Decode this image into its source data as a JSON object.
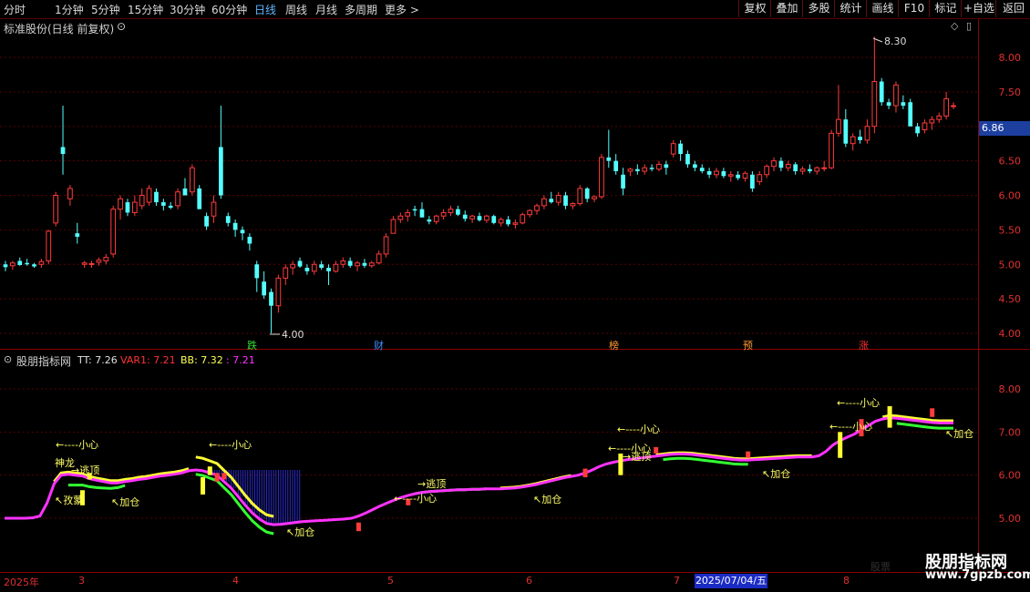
{
  "toolbar": {
    "periods": [
      "分时",
      "1分钟",
      "5分钟",
      "15分钟",
      "30分钟",
      "60分钟",
      "日线",
      "周线",
      "月线",
      "多周期",
      "更多 >"
    ],
    "active_period": "日线",
    "buttons": [
      "复权",
      "叠加",
      "多股",
      "统计",
      "画线",
      "F10",
      "标记",
      "+自选",
      "返回"
    ]
  },
  "main_panel": {
    "title": "标准股份(日线 前复权)",
    "y_ticks": [
      "8.00",
      "7.50",
      "7.00",
      "6.50",
      "6.00",
      "5.50",
      "5.00",
      "4.50",
      "4.00"
    ],
    "current_price": "6.86",
    "high_label": "8.30",
    "low_label": "4.00",
    "events": [
      {
        "text": "跌",
        "color": "#33dd33"
      },
      {
        "text": "财",
        "color": "#3d8fff"
      },
      {
        "text": "榜",
        "color": "#ff9933"
      },
      {
        "text": "预",
        "color": "#ff9933"
      },
      {
        "text": "涨",
        "color": "#ff3333"
      }
    ]
  },
  "indicator_panel": {
    "title": "股朋指标网",
    "tt": "TT: 7.26",
    "var1": "VAR1: 7.21",
    "bb": "BB: 7.32",
    "extra": ": 7.21",
    "y_ticks": [
      "8.00",
      "7.00",
      "6.00",
      "5.00"
    ],
    "annotations": {
      "caution": "←----小心",
      "escape": "→逃顶",
      "add": "↖加仓",
      "shenlong": "神龙",
      "nizhuan": "↖孜蒙"
    }
  },
  "x_axis": {
    "labels": [
      "2025年",
      "3",
      "4",
      "5",
      "6",
      "7",
      "8"
    ],
    "cursor_date": "2025/07/04/五"
  },
  "colors": {
    "up": "#ff3b3b",
    "down": "#54ffff",
    "grid": "#5a0000",
    "magenta": "#ff33ff",
    "green": "#33ff33",
    "yellow": "#ffff33"
  },
  "chart_data": {
    "type": "candlestick",
    "ohlc": [
      [
        5.0,
        5.05,
        4.9,
        4.96
      ],
      [
        4.98,
        5.05,
        4.92,
        5.02
      ],
      [
        5.05,
        5.1,
        4.98,
        4.99
      ],
      [
        5.02,
        5.08,
        4.98,
        5.0
      ],
      [
        5.0,
        5.02,
        4.95,
        4.97
      ],
      [
        5.0,
        5.08,
        4.95,
        5.04
      ],
      [
        5.05,
        5.5,
        5.0,
        5.48
      ],
      [
        5.6,
        6.05,
        5.55,
        6.0
      ],
      [
        6.7,
        7.3,
        6.3,
        6.6
      ],
      [
        5.95,
        6.15,
        5.85,
        6.1
      ],
      [
        5.45,
        5.6,
        5.3,
        5.4
      ],
      [
        5.0,
        5.05,
        4.95,
        5.02
      ],
      [
        5.0,
        5.05,
        4.95,
        5.01
      ],
      [
        5.03,
        5.1,
        4.98,
        5.06
      ],
      [
        5.05,
        5.15,
        5.0,
        5.1
      ],
      [
        5.15,
        5.85,
        5.1,
        5.8
      ],
      [
        5.8,
        6.0,
        5.65,
        5.95
      ],
      [
        5.9,
        5.95,
        5.7,
        5.75
      ],
      [
        5.75,
        6.0,
        5.7,
        5.9
      ],
      [
        5.85,
        6.1,
        5.8,
        6.0
      ],
      [
        5.9,
        6.15,
        5.85,
        6.1
      ],
      [
        6.05,
        6.1,
        5.85,
        5.9
      ],
      [
        5.9,
        5.95,
        5.78,
        5.85
      ],
      [
        5.85,
        5.9,
        5.8,
        5.82
      ],
      [
        5.85,
        6.1,
        5.8,
        6.05
      ],
      [
        6.1,
        6.25,
        6.0,
        6.0
      ],
      [
        6.05,
        6.45,
        6.0,
        6.4
      ],
      [
        6.1,
        6.15,
        5.8,
        5.8
      ],
      [
        5.7,
        5.75,
        5.5,
        5.55
      ],
      [
        5.7,
        6.0,
        5.6,
        5.9
      ],
      [
        6.7,
        7.3,
        5.95,
        6.0
      ],
      [
        5.7,
        5.75,
        5.55,
        5.6
      ],
      [
        5.6,
        5.65,
        5.4,
        5.5
      ],
      [
        5.5,
        5.55,
        5.35,
        5.45
      ],
      [
        5.4,
        5.45,
        5.2,
        5.3
      ],
      [
        5.0,
        5.05,
        4.6,
        4.8
      ],
      [
        4.75,
        4.9,
        4.5,
        4.55
      ],
      [
        4.6,
        4.65,
        4.0,
        4.4
      ],
      [
        4.4,
        4.85,
        4.3,
        4.8
      ],
      [
        4.8,
        5.0,
        4.7,
        4.95
      ],
      [
        4.95,
        5.05,
        4.85,
        5.0
      ],
      [
        5.05,
        5.1,
        4.95,
        4.97
      ],
      [
        4.95,
        5.0,
        4.85,
        4.9
      ],
      [
        4.9,
        5.05,
        4.85,
        5.0
      ],
      [
        5.0,
        5.05,
        4.92,
        4.95
      ],
      [
        4.95,
        5.0,
        4.7,
        4.9
      ],
      [
        4.9,
        5.05,
        4.88,
        5.0
      ],
      [
        5.0,
        5.1,
        4.95,
        5.05
      ],
      [
        5.05,
        5.1,
        4.95,
        4.98
      ],
      [
        4.98,
        5.05,
        4.9,
        5.02
      ],
      [
        5.02,
        5.08,
        4.95,
        4.98
      ],
      [
        4.98,
        5.05,
        4.95,
        5.02
      ],
      [
        5.02,
        5.2,
        5.0,
        5.15
      ],
      [
        5.15,
        5.45,
        5.1,
        5.4
      ],
      [
        5.45,
        5.7,
        5.45,
        5.65
      ],
      [
        5.65,
        5.75,
        5.6,
        5.7
      ],
      [
        5.7,
        5.8,
        5.62,
        5.75
      ],
      [
        5.8,
        5.85,
        5.7,
        5.78
      ],
      [
        5.8,
        5.9,
        5.7,
        5.68
      ],
      [
        5.65,
        5.7,
        5.58,
        5.62
      ],
      [
        5.62,
        5.72,
        5.58,
        5.7
      ],
      [
        5.7,
        5.8,
        5.65,
        5.75
      ],
      [
        5.75,
        5.85,
        5.7,
        5.8
      ],
      [
        5.8,
        5.85,
        5.7,
        5.72
      ],
      [
        5.72,
        5.78,
        5.62,
        5.66
      ],
      [
        5.66,
        5.72,
        5.6,
        5.7
      ],
      [
        5.7,
        5.75,
        5.62,
        5.64
      ],
      [
        5.64,
        5.72,
        5.6,
        5.7
      ],
      [
        5.7,
        5.72,
        5.58,
        5.6
      ],
      [
        5.6,
        5.68,
        5.55,
        5.65
      ],
      [
        5.65,
        5.7,
        5.55,
        5.58
      ],
      [
        5.58,
        5.65,
        5.52,
        5.6
      ],
      [
        5.6,
        5.75,
        5.58,
        5.72
      ],
      [
        5.72,
        5.8,
        5.68,
        5.78
      ],
      [
        5.78,
        5.88,
        5.72,
        5.85
      ],
      [
        5.85,
        6.0,
        5.8,
        5.95
      ],
      [
        5.95,
        6.05,
        5.88,
        5.9
      ],
      [
        5.9,
        6.05,
        5.85,
        6.0
      ],
      [
        6.0,
        6.05,
        5.8,
        5.85
      ],
      [
        5.85,
        5.9,
        5.8,
        5.88
      ],
      [
        5.88,
        6.15,
        5.85,
        6.1
      ],
      [
        6.1,
        6.12,
        5.9,
        5.95
      ],
      [
        5.95,
        6.0,
        5.9,
        5.98
      ],
      [
        5.98,
        6.6,
        5.95,
        6.55
      ],
      [
        6.55,
        6.95,
        6.4,
        6.5
      ],
      [
        6.5,
        6.6,
        6.3,
        6.35
      ],
      [
        6.3,
        6.4,
        6.0,
        6.1
      ],
      [
        6.35,
        6.4,
        6.28,
        6.38
      ],
      [
        6.38,
        6.45,
        6.3,
        6.35
      ],
      [
        6.35,
        6.45,
        6.3,
        6.4
      ],
      [
        6.4,
        6.45,
        6.35,
        6.38
      ],
      [
        6.38,
        6.5,
        6.35,
        6.45
      ],
      [
        6.45,
        6.5,
        6.3,
        6.4
      ],
      [
        6.6,
        6.8,
        6.55,
        6.75
      ],
      [
        6.75,
        6.8,
        6.5,
        6.6
      ],
      [
        6.6,
        6.65,
        6.4,
        6.45
      ],
      [
        6.45,
        6.5,
        6.35,
        6.4
      ],
      [
        6.4,
        6.45,
        6.32,
        6.35
      ],
      [
        6.35,
        6.4,
        6.25,
        6.3
      ],
      [
        6.3,
        6.4,
        6.25,
        6.35
      ],
      [
        6.35,
        6.4,
        6.25,
        6.28
      ],
      [
        6.28,
        6.35,
        6.2,
        6.3
      ],
      [
        6.3,
        6.35,
        6.22,
        6.25
      ],
      [
        6.25,
        6.35,
        6.2,
        6.32
      ],
      [
        6.3,
        6.35,
        6.05,
        6.1
      ],
      [
        6.2,
        6.35,
        6.15,
        6.3
      ],
      [
        6.3,
        6.45,
        6.25,
        6.42
      ],
      [
        6.42,
        6.55,
        6.35,
        6.5
      ],
      [
        6.5,
        6.55,
        6.35,
        6.4
      ],
      [
        6.4,
        6.5,
        6.35,
        6.45
      ],
      [
        6.45,
        6.48,
        6.3,
        6.35
      ],
      [
        6.35,
        6.42,
        6.3,
        6.38
      ],
      [
        6.38,
        6.45,
        6.32,
        6.35
      ],
      [
        6.35,
        6.42,
        6.3,
        6.4
      ],
      [
        6.4,
        6.5,
        6.35,
        6.4
      ],
      [
        6.4,
        6.95,
        6.38,
        6.9
      ],
      [
        6.9,
        7.6,
        6.85,
        7.1
      ],
      [
        7.1,
        7.25,
        6.7,
        6.75
      ],
      [
        6.75,
        6.9,
        6.65,
        6.85
      ],
      [
        6.85,
        6.95,
        6.75,
        6.8
      ],
      [
        6.8,
        7.1,
        6.75,
        7.0
      ],
      [
        7.0,
        8.3,
        6.9,
        7.65
      ],
      [
        7.65,
        7.7,
        7.3,
        7.35
      ],
      [
        7.35,
        7.4,
        7.25,
        7.3
      ],
      [
        7.3,
        7.65,
        7.2,
        7.6
      ],
      [
        7.35,
        7.45,
        7.25,
        7.3
      ],
      [
        7.35,
        7.4,
        7.0,
        7.0
      ],
      [
        7.0,
        7.05,
        6.85,
        6.9
      ],
      [
        6.95,
        7.1,
        6.9,
        7.05
      ],
      [
        7.05,
        7.15,
        6.95,
        7.1
      ],
      [
        7.1,
        7.2,
        7.05,
        7.15
      ],
      [
        7.15,
        7.5,
        7.1,
        7.4
      ],
      [
        7.3,
        7.35,
        7.25,
        7.3
      ]
    ],
    "indicator_line": [
      5.0,
      5.0,
      5.0,
      5.0,
      5.01,
      5.05,
      5.35,
      5.8,
      6.0,
      6.02,
      6.0,
      5.98,
      5.92,
      5.88,
      5.85,
      5.82,
      5.82,
      5.85,
      5.87,
      5.9,
      5.92,
      5.95,
      5.98,
      6.0,
      6.02,
      6.05,
      6.1,
      6.12,
      6.1,
      6.05,
      6.0,
      5.85,
      5.7,
      5.5,
      5.3,
      5.12,
      4.98,
      4.88,
      4.85,
      4.86,
      4.88,
      4.9,
      4.92,
      4.93,
      4.94,
      4.95,
      4.96,
      4.97,
      4.98,
      5.0,
      5.05,
      5.12,
      5.2,
      5.28,
      5.35,
      5.42,
      5.48,
      5.53,
      5.57,
      5.6,
      5.62,
      5.63,
      5.64,
      5.65,
      5.66,
      5.66,
      5.67,
      5.67,
      5.68,
      5.68,
      5.68,
      5.69,
      5.7,
      5.72,
      5.75,
      5.78,
      5.82,
      5.86,
      5.9,
      5.94,
      5.97,
      6.0,
      6.05,
      6.12,
      6.2,
      6.26,
      6.3,
      6.33,
      6.36,
      6.38,
      6.4,
      6.42,
      6.44,
      6.46,
      6.48,
      6.49,
      6.49,
      6.48,
      6.46,
      6.44,
      6.42,
      6.4,
      6.38,
      6.36,
      6.35,
      6.35,
      6.36,
      6.37,
      6.38,
      6.39,
      6.4,
      6.41,
      6.42,
      6.42,
      6.42,
      6.45,
      6.55,
      6.7,
      6.8,
      6.88,
      6.95,
      7.05,
      7.15,
      7.25,
      7.3,
      7.33,
      7.32,
      7.3,
      7.28,
      7.26,
      7.24,
      7.22,
      7.21,
      7.21,
      7.21
    ]
  }
}
